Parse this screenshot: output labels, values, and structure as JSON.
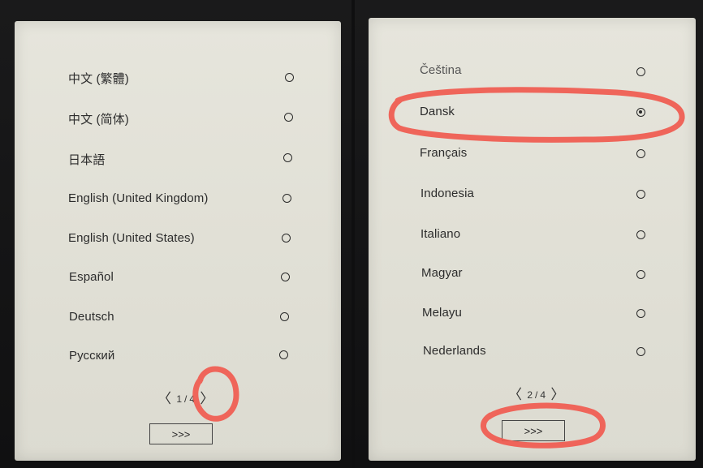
{
  "left_page": {
    "languages": [
      "中文 (繁體)",
      "中文 (简体)",
      "日本語",
      "English (United Kingdom)",
      "English (United States)",
      "Español",
      "Deutsch",
      "Русский"
    ],
    "pager": {
      "current": "1",
      "separator": "/",
      "total": "4"
    },
    "next_label": ">>>"
  },
  "right_page": {
    "languages": [
      "Čeština",
      "Dansk",
      "Français",
      "Indonesia",
      "Italiano",
      "Magyar",
      "Melayu",
      "Nederlands"
    ],
    "selected_language": "Dansk",
    "pager": {
      "current": "2",
      "separator": "/",
      "total": "4"
    },
    "next_label": ">>>"
  },
  "colors": {
    "annotation": "#f05a4f",
    "screen": "#e2e1d7",
    "text": "#2c2c2c"
  },
  "icons": {
    "radio": "radio-circle-icon",
    "prev": "chevron-left-icon",
    "next": "chevron-right-icon"
  }
}
